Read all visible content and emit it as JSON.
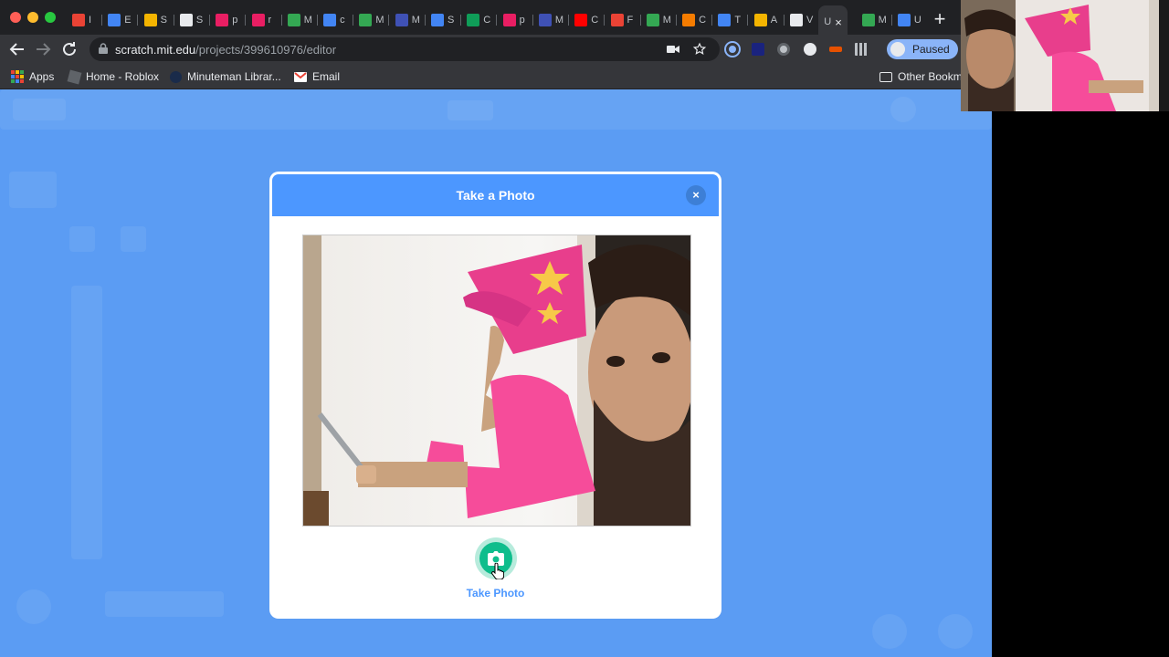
{
  "browser": {
    "tabs": [
      {
        "letter": "I",
        "icon": "gmail-icon",
        "color": "#ea4335"
      },
      {
        "letter": "E",
        "icon": "docs-icon",
        "color": "#4285f4"
      },
      {
        "letter": "S",
        "icon": "slides-icon",
        "color": "#f4b400"
      },
      {
        "letter": "S",
        "icon": "globe-icon",
        "color": "#e8eaed"
      },
      {
        "letter": "p",
        "icon": "star-icon",
        "color": "#e91e63"
      },
      {
        "letter": "r",
        "icon": "star-icon",
        "color": "#e91e63"
      },
      {
        "letter": "M",
        "icon": "drive-icon",
        "color": "#34a853"
      },
      {
        "letter": "c",
        "icon": "google-icon",
        "color": "#4285f4"
      },
      {
        "letter": "M",
        "icon": "drive-icon",
        "color": "#34a853"
      },
      {
        "letter": "M",
        "icon": "calendar-icon",
        "color": "#3f51b5"
      },
      {
        "letter": "S",
        "icon": "docs-icon",
        "color": "#4285f4"
      },
      {
        "letter": "C",
        "icon": "sheets-icon",
        "color": "#0f9d58"
      },
      {
        "letter": "p",
        "icon": "star-icon",
        "color": "#e91e63"
      },
      {
        "letter": "M",
        "icon": "calendar-icon",
        "color": "#3f51b5"
      },
      {
        "letter": "C",
        "icon": "youtube-icon",
        "color": "#ff0000"
      },
      {
        "letter": "F",
        "icon": "gmail-icon",
        "color": "#ea4335"
      },
      {
        "letter": "M",
        "icon": "drive-icon",
        "color": "#34a853"
      },
      {
        "letter": "C",
        "icon": "classroom-icon",
        "color": "#f57c00"
      },
      {
        "letter": "T",
        "icon": "docs-icon",
        "color": "#4285f4"
      },
      {
        "letter": "A",
        "icon": "slides-icon",
        "color": "#f4b400"
      },
      {
        "letter": "V",
        "icon": "page-icon",
        "color": "#e8eaed"
      },
      {
        "letter": "U",
        "icon": "",
        "color": "",
        "active": true
      },
      {
        "letter": "M",
        "icon": "drive-icon",
        "color": "#34a853"
      },
      {
        "letter": "U",
        "icon": "docs-icon",
        "color": "#4285f4"
      }
    ],
    "active_tab_close": "×",
    "new_tab": "+",
    "url_host": "scratch.mit.edu",
    "url_path": "/projects/399610976/editor",
    "profile_label": "Paused",
    "bookmarks": {
      "apps": "Apps",
      "roblox": "Home - Roblox",
      "minuteman": "Minuteman Librar...",
      "email": "Email",
      "other": "Other Bookma"
    }
  },
  "modal": {
    "title": "Take a Photo",
    "close_glyph": "×",
    "shutter_label": "Take Photo",
    "accent": "#4c97ff",
    "shutter_color": "#0fbd8c"
  },
  "page": {
    "overlay_color": "#5b9cf3"
  }
}
